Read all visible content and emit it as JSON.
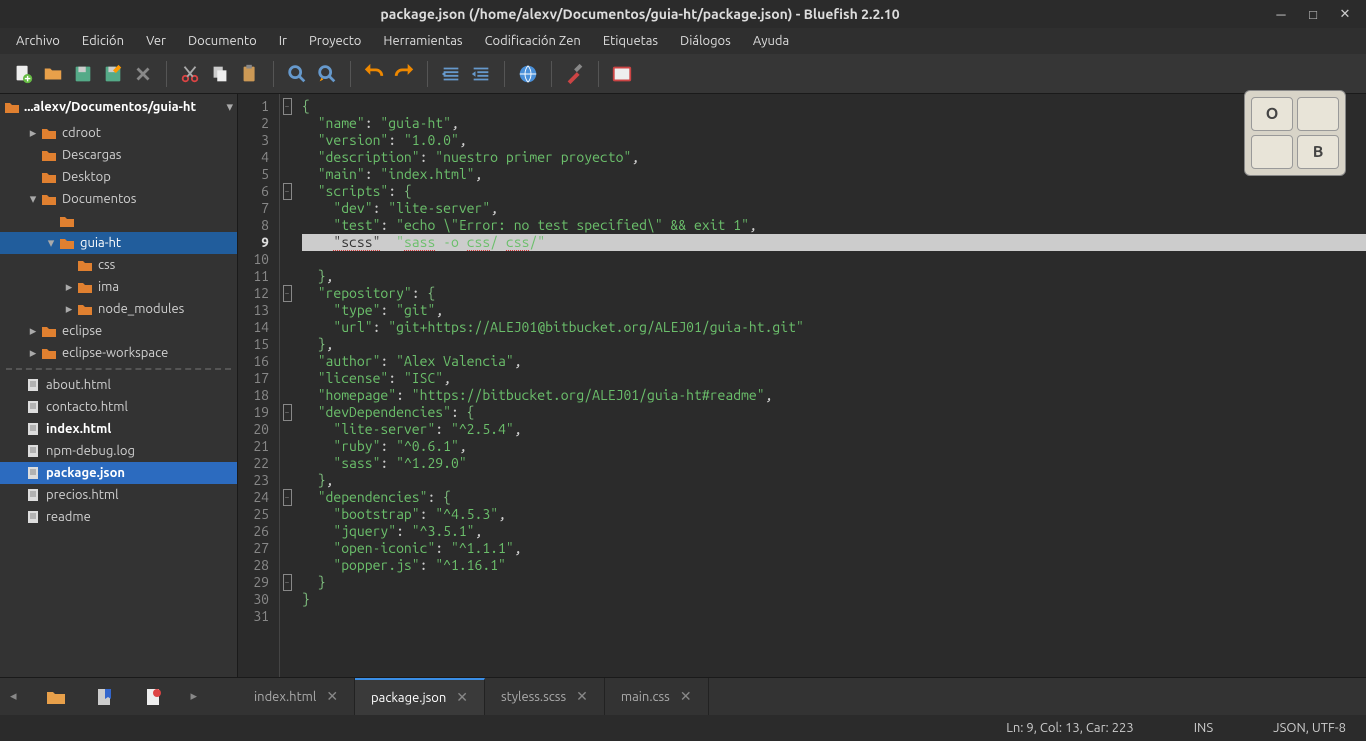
{
  "title": "package.json (/home/alexv/Documentos/guia-ht/package.json) - Bluefish 2.2.10",
  "menu": [
    "Archivo",
    "Edición",
    "Ver",
    "Documento",
    "Ir",
    "Proyecto",
    "Herramientas",
    "Codificación Zen",
    "Etiquetas",
    "Diálogos",
    "Ayuda"
  ],
  "sidebar_path": "...alexv/Documentos/guia-ht",
  "tree": [
    {
      "level": 1,
      "arrow": "▸",
      "icon": "folder",
      "label": "cdroot"
    },
    {
      "level": 1,
      "arrow": "",
      "icon": "folder",
      "label": "Descargas"
    },
    {
      "level": 1,
      "arrow": "",
      "icon": "folder",
      "label": "Desktop"
    },
    {
      "level": 1,
      "arrow": "▾",
      "icon": "folder",
      "label": "Documentos"
    },
    {
      "level": 2,
      "arrow": "",
      "icon": "folder",
      "label": ""
    },
    {
      "level": 2,
      "arrow": "▾",
      "icon": "folder",
      "label": "guia-ht",
      "sel": "sel"
    },
    {
      "level": 3,
      "arrow": "",
      "icon": "folder",
      "label": "css"
    },
    {
      "level": 3,
      "arrow": "▸",
      "icon": "folder",
      "label": "ima"
    },
    {
      "level": 3,
      "arrow": "▸",
      "icon": "folder",
      "label": "node_modules"
    },
    {
      "level": 1,
      "arrow": "▸",
      "icon": "folder",
      "label": "eclipse"
    },
    {
      "level": 1,
      "arrow": "▸",
      "icon": "folder",
      "label": "eclipse-workspace"
    }
  ],
  "files": [
    {
      "icon": "file",
      "label": "about.html"
    },
    {
      "icon": "file",
      "label": "contacto.html"
    },
    {
      "icon": "file",
      "label": "index.html",
      "bold": true
    },
    {
      "icon": "file",
      "label": "npm-debug.log"
    },
    {
      "icon": "file",
      "label": "package.json",
      "bold": true,
      "sel": "sel-active"
    },
    {
      "icon": "file",
      "label": "precios.html"
    },
    {
      "icon": "file",
      "label": "readme"
    }
  ],
  "code": [
    "{",
    "  \"name\": \"guia-ht\",",
    "  \"version\": \"1.0.0\",",
    "  \"description\": \"nuestro primer proyecto\",",
    "  \"main\": \"index.html\",",
    "  \"scripts\": {",
    "    \"dev\": \"lite-server\",",
    "    \"test\": \"echo \\\"Error: no test specified\\\" && exit 1\",",
    "    \"scss\"  \"sass -o css/ css/\"",
    "",
    "  },",
    "  \"repository\": {",
    "    \"type\": \"git\",",
    "    \"url\": \"git+https://ALEJ01@bitbucket.org/ALEJ01/guia-ht.git\"",
    "  },",
    "  \"author\": \"Alex Valencia\",",
    "  \"license\": \"ISC\",",
    "  \"homepage\": \"https://bitbucket.org/ALEJ01/guia-ht#readme\",",
    "  \"devDependencies\": {",
    "    \"lite-server\": \"^2.5.4\",",
    "    \"ruby\": \"^0.6.1\",",
    "    \"sass\": \"^1.29.0\"",
    "  },",
    "  \"dependencies\": {",
    "    \"bootstrap\": \"^4.5.3\",",
    "    \"jquery\": \"^3.5.1\",",
    "    \"open-iconic\": \"^1.1.1\",",
    "    \"popper.js\": \"^1.16.1\"",
    "  }",
    "}",
    ""
  ],
  "open_tabs": [
    {
      "label": "index.html"
    },
    {
      "label": "package.json",
      "active": true
    },
    {
      "label": "styless.scss"
    },
    {
      "label": "main.css"
    }
  ],
  "status": {
    "pos": "Ln: 9, Col: 13, Car: 223",
    "mode": "INS",
    "enc": "JSON, UTF-8"
  },
  "folds": [
    1,
    6,
    12,
    19,
    24,
    29
  ],
  "kbd": [
    "O",
    "",
    "",
    "B"
  ]
}
